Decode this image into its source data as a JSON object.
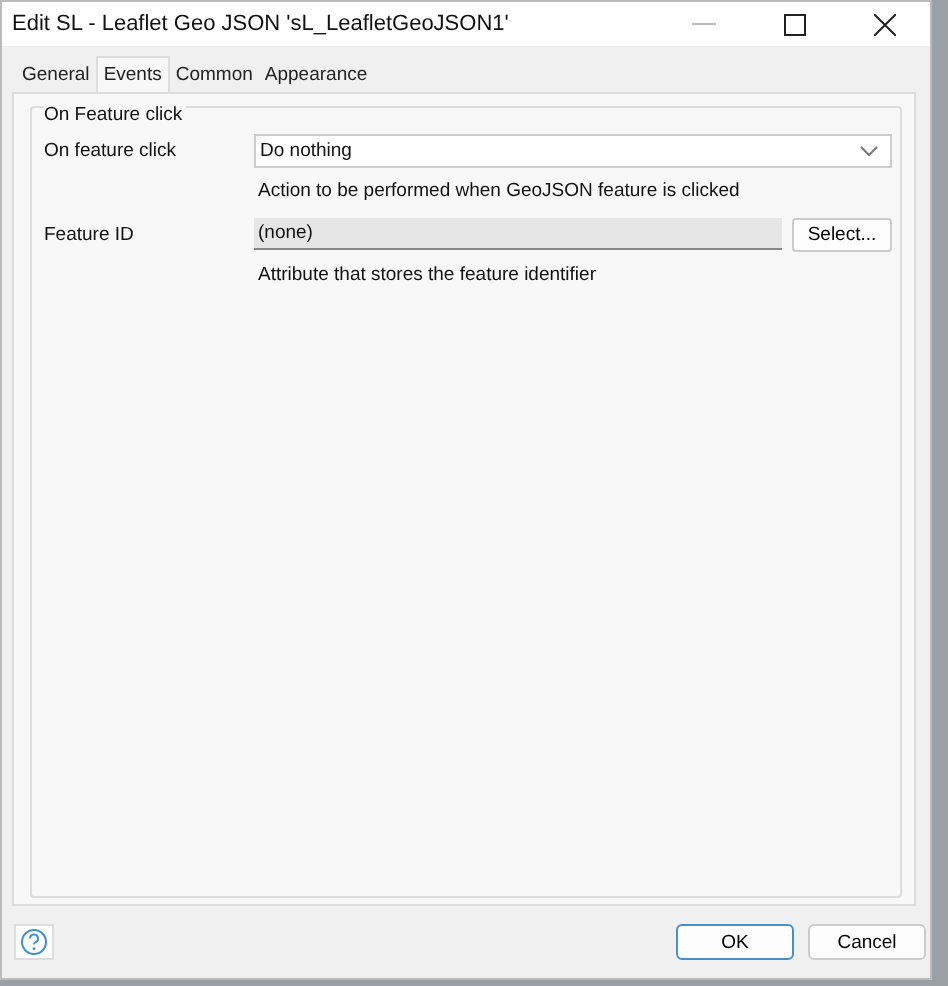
{
  "window": {
    "title": "Edit SL - Leaflet Geo JSON 'sL_LeafletGeoJSON1'"
  },
  "tabs": [
    {
      "label": "General",
      "selected": false
    },
    {
      "label": "Events",
      "selected": true
    },
    {
      "label": "Common",
      "selected": false
    },
    {
      "label": "Appearance",
      "selected": false
    }
  ],
  "group": {
    "title": "On Feature click",
    "rows": [
      {
        "kind": "dropdown",
        "label": "On feature click",
        "value": "Do nothing",
        "hint": "Action to be performed when GeoJSON feature is clicked"
      },
      {
        "kind": "picker",
        "label": "Feature ID",
        "value": "(none)",
        "button": "Select...",
        "hint": "Attribute that stores the feature identifier"
      }
    ]
  },
  "buttons": [
    {
      "label": "OK",
      "default": true
    },
    {
      "label": "Cancel",
      "default": false
    }
  ]
}
